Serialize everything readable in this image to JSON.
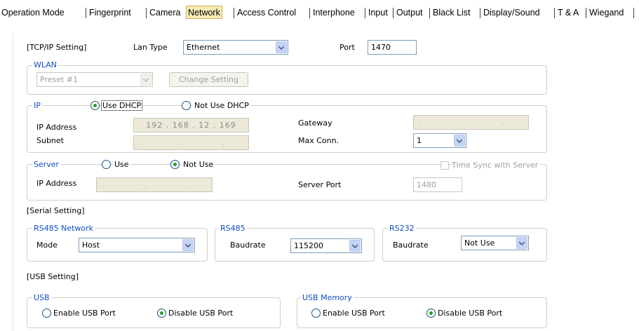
{
  "tabs": [
    {
      "label": "Operation Mode",
      "selected": false
    },
    {
      "label": "Fingerprint",
      "selected": false
    },
    {
      "label": "Camera",
      "selected": false
    },
    {
      "label": "Network",
      "selected": true
    },
    {
      "label": "Access Control",
      "selected": false
    },
    {
      "label": "Interphone",
      "selected": false
    },
    {
      "label": "Input",
      "selected": false
    },
    {
      "label": "Output",
      "selected": false
    },
    {
      "label": "Black List",
      "selected": false
    },
    {
      "label": "Display/Sound",
      "selected": false
    },
    {
      "label": "T & A",
      "selected": false
    },
    {
      "label": "Wiegand",
      "selected": false
    }
  ],
  "tcpip": {
    "heading": "[TCP/IP Setting]",
    "lan_type_label": "Lan Type",
    "lan_type_value": "Ethernet",
    "port_label": "Port",
    "port_value": "1470"
  },
  "wlan": {
    "legend": "WLAN",
    "preset_value": "Preset #1",
    "change_button": "Change Setting"
  },
  "ip": {
    "legend": "IP",
    "use_dhcp": "Use DHCP",
    "not_use_dhcp": "Not Use DHCP",
    "selected": "use_dhcp",
    "ip_address_label": "IP Address",
    "ip_address_value": "192 . 168 . 12 . 169",
    "subnet_label": "Subnet",
    "subnet_value": ". . .",
    "gateway_label": "Gateway",
    "gateway_value": ". . .",
    "max_conn_label": "Max Conn.",
    "max_conn_value": "1"
  },
  "server": {
    "legend": "Server",
    "use": "Use",
    "not_use": "Not Use",
    "selected": "not_use",
    "time_sync_label": "Time Sync with Server",
    "time_sync_checked": false,
    "ip_address_label": "IP Address",
    "ip_address_value": ". . .",
    "server_port_label": "Server Port",
    "server_port_value": "1480"
  },
  "serial": {
    "heading": "[Serial Setting]",
    "rs485_network_legend": "RS485 Network",
    "mode_label": "Mode",
    "mode_value": "Host",
    "rs485_legend": "RS485",
    "rs485_baud_label": "Baudrate",
    "rs485_baud_value": "115200",
    "rs232_legend": "RS232",
    "rs232_baud_label": "Baudrate",
    "rs232_baud_value": "Not Use"
  },
  "usb": {
    "heading": "[USB Setting]",
    "usb_legend": "USB",
    "usb_enable": "Enable USB Port",
    "usb_disable": "Disable USB Port",
    "usb_selected": "disable",
    "mem_legend": "USB Memory",
    "mem_enable": "Enable USB Port",
    "mem_disable": "Disable USB Port",
    "mem_selected": "disable"
  },
  "colors": {
    "accent_blue": "#0f4fc1",
    "selected_tab": "#f6ecb3",
    "radio_dot": "#21a121"
  }
}
